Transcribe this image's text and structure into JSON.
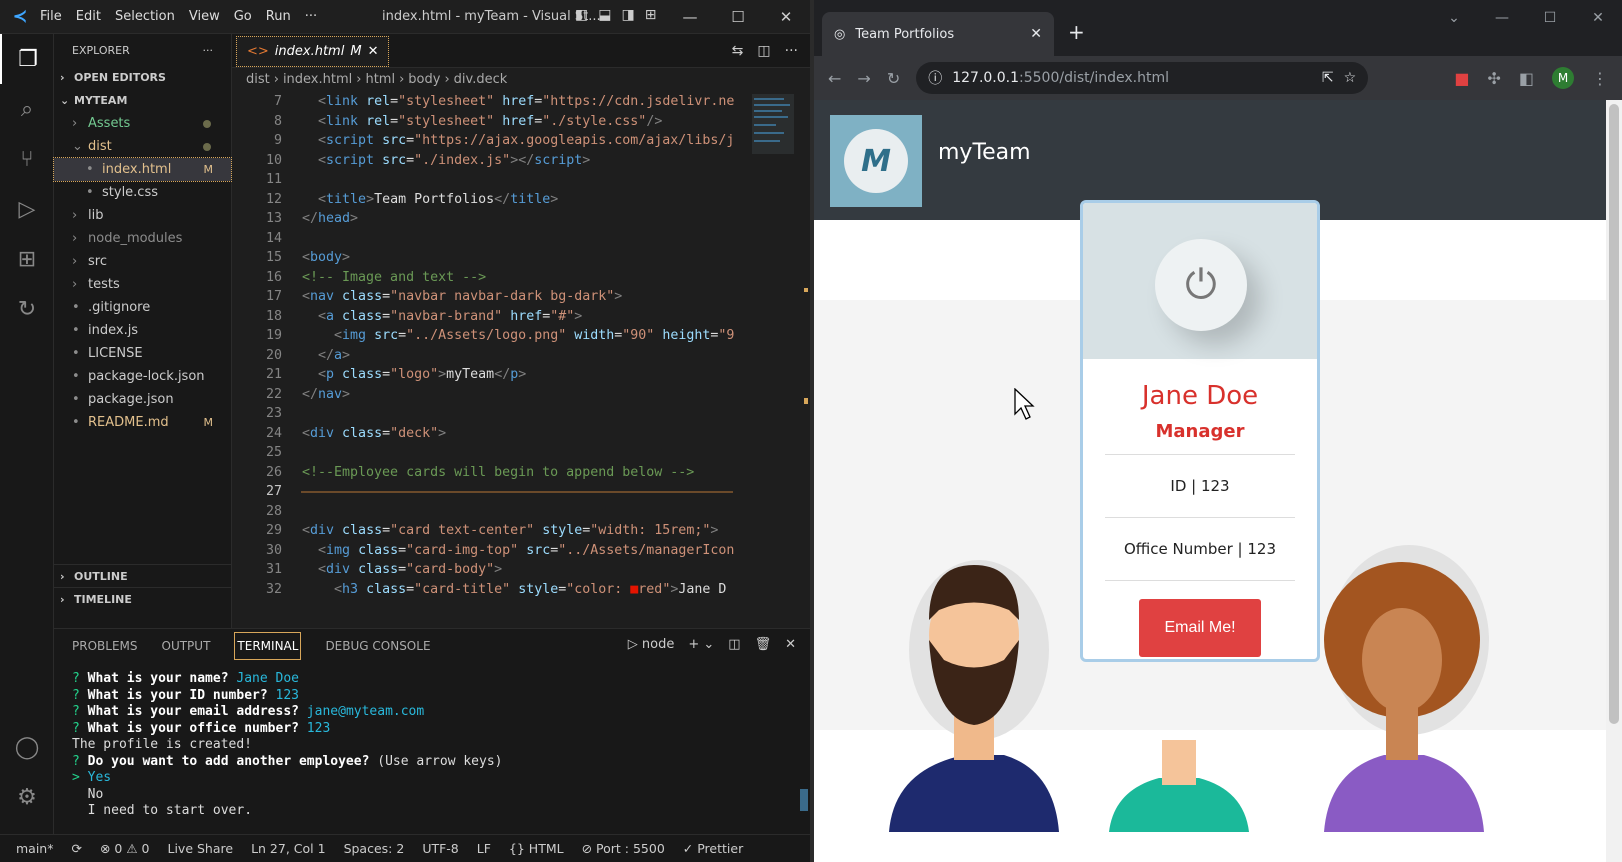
{
  "vscode": {
    "menu": [
      "File",
      "Edit",
      "Selection",
      "View",
      "Go",
      "Run",
      "···"
    ],
    "window_title": "index.html - myTeam - Visual St...",
    "explorer": {
      "title": "EXPLORER",
      "open_editors": "OPEN EDITORS",
      "project": "MYTEAM",
      "items": [
        {
          "label": "Assets",
          "type": "folder",
          "indent": 1,
          "decor": "dot",
          "color": "#73c991"
        },
        {
          "label": "dist",
          "type": "folder-open",
          "indent": 1,
          "decor": "dot",
          "color": "#e2c08d"
        },
        {
          "label": "index.html",
          "type": "file",
          "indent": 2,
          "decor": "M",
          "color": "#e2c08d",
          "selected": true
        },
        {
          "label": "style.css",
          "type": "file",
          "indent": 2,
          "color": "#ccc"
        },
        {
          "label": "lib",
          "type": "folder",
          "indent": 1,
          "color": "#ccc"
        },
        {
          "label": "node_modules",
          "type": "folder",
          "indent": 1,
          "color": "#8c8c8c"
        },
        {
          "label": "src",
          "type": "folder",
          "indent": 1,
          "color": "#ccc"
        },
        {
          "label": "tests",
          "type": "folder",
          "indent": 1,
          "color": "#ccc"
        },
        {
          "label": ".gitignore",
          "type": "file",
          "indent": 1,
          "color": "#ccc"
        },
        {
          "label": "index.js",
          "type": "file",
          "indent": 1,
          "color": "#ccc"
        },
        {
          "label": "LICENSE",
          "type": "file",
          "indent": 1,
          "color": "#ccc"
        },
        {
          "label": "package-lock.json",
          "type": "file",
          "indent": 1,
          "color": "#ccc"
        },
        {
          "label": "package.json",
          "type": "file",
          "indent": 1,
          "color": "#ccc"
        },
        {
          "label": "README.md",
          "type": "file",
          "indent": 1,
          "decor": "M",
          "color": "#e2c08d"
        }
      ],
      "outline": "OUTLINE",
      "timeline": "TIMELINE"
    },
    "tab": {
      "label": "index.html",
      "mark": "M"
    },
    "breadcrumb": [
      "dist",
      "index.html",
      "html",
      "body",
      "div.deck"
    ],
    "code": [
      {
        "n": "7",
        "parts": [
          [
            "tag",
            "  <"
          ],
          [
            "tn",
            "link "
          ],
          [
            "an",
            "rel"
          ],
          [
            "tt",
            "="
          ],
          [
            "av",
            "\"stylesheet\" "
          ],
          [
            "an",
            "href"
          ],
          [
            "tt",
            "="
          ],
          [
            "av",
            "\"https://cdn.jsdelivr.ne"
          ]
        ]
      },
      {
        "n": "8",
        "parts": [
          [
            "tag",
            "  <"
          ],
          [
            "tn",
            "link "
          ],
          [
            "an",
            "rel"
          ],
          [
            "tt",
            "="
          ],
          [
            "av",
            "\"stylesheet\" "
          ],
          [
            "an",
            "href"
          ],
          [
            "tt",
            "="
          ],
          [
            "av",
            "\"./style.css\""
          ],
          [
            "tag",
            "/>"
          ]
        ]
      },
      {
        "n": "9",
        "parts": [
          [
            "tag",
            "  <"
          ],
          [
            "tn",
            "script "
          ],
          [
            "an",
            "src"
          ],
          [
            "tt",
            "="
          ],
          [
            "av",
            "\"https://ajax.googleapis.com/ajax/libs/j"
          ]
        ]
      },
      {
        "n": "10",
        "parts": [
          [
            "tag",
            "  <"
          ],
          [
            "tn",
            "script "
          ],
          [
            "an",
            "src"
          ],
          [
            "tt",
            "="
          ],
          [
            "av",
            "\"./index.js\""
          ],
          [
            "tag",
            "></"
          ],
          [
            "tn",
            "script"
          ],
          [
            "tag",
            ">"
          ]
        ]
      },
      {
        "n": "11",
        "parts": []
      },
      {
        "n": "12",
        "parts": [
          [
            "tag",
            "  <"
          ],
          [
            "tn",
            "title"
          ],
          [
            "tag",
            ">"
          ],
          [
            "tt",
            "Team Portfolios"
          ],
          [
            "tag",
            "</"
          ],
          [
            "tn",
            "title"
          ],
          [
            "tag",
            ">"
          ]
        ]
      },
      {
        "n": "13",
        "parts": [
          [
            "tag",
            "</"
          ],
          [
            "tn",
            "head"
          ],
          [
            "tag",
            ">"
          ]
        ]
      },
      {
        "n": "14",
        "parts": []
      },
      {
        "n": "15",
        "parts": [
          [
            "tag",
            "<"
          ],
          [
            "tn",
            "body"
          ],
          [
            "tag",
            ">"
          ]
        ]
      },
      {
        "n": "16",
        "parts": [
          [
            "cm",
            "<!-- Image and text -->"
          ]
        ]
      },
      {
        "n": "17",
        "parts": [
          [
            "tag",
            "<"
          ],
          [
            "tn",
            "nav "
          ],
          [
            "an",
            "class"
          ],
          [
            "tt",
            "="
          ],
          [
            "av",
            "\"navbar navbar-dark bg-dark\""
          ],
          [
            "tag",
            ">"
          ]
        ]
      },
      {
        "n": "18",
        "parts": [
          [
            "tag",
            "  <"
          ],
          [
            "tn",
            "a "
          ],
          [
            "an",
            "class"
          ],
          [
            "tt",
            "="
          ],
          [
            "av",
            "\"navbar-brand\" "
          ],
          [
            "an",
            "href"
          ],
          [
            "tt",
            "="
          ],
          [
            "av",
            "\"#\""
          ],
          [
            "tag",
            ">"
          ]
        ]
      },
      {
        "n": "19",
        "parts": [
          [
            "tag",
            "    <"
          ],
          [
            "tn",
            "img "
          ],
          [
            "an",
            "src"
          ],
          [
            "tt",
            "="
          ],
          [
            "av",
            "\"../Assets/logo.png\" "
          ],
          [
            "an",
            "width"
          ],
          [
            "tt",
            "="
          ],
          [
            "av",
            "\"90\" "
          ],
          [
            "an",
            "height"
          ],
          [
            "tt",
            "="
          ],
          [
            "av",
            "\"9"
          ]
        ]
      },
      {
        "n": "20",
        "parts": [
          [
            "tag",
            "  </"
          ],
          [
            "tn",
            "a"
          ],
          [
            "tag",
            ">"
          ]
        ]
      },
      {
        "n": "21",
        "parts": [
          [
            "tag",
            "  <"
          ],
          [
            "tn",
            "p "
          ],
          [
            "an",
            "class"
          ],
          [
            "tt",
            "="
          ],
          [
            "av",
            "\"logo\""
          ],
          [
            "tag",
            ">"
          ],
          [
            "tt",
            "myTeam"
          ],
          [
            "tag",
            "</"
          ],
          [
            "tn",
            "p"
          ],
          [
            "tag",
            ">"
          ]
        ]
      },
      {
        "n": "22",
        "parts": [
          [
            "tag",
            "</"
          ],
          [
            "tn",
            "nav"
          ],
          [
            "tag",
            ">"
          ]
        ]
      },
      {
        "n": "23",
        "parts": []
      },
      {
        "n": "24",
        "parts": [
          [
            "tag",
            "<"
          ],
          [
            "tn",
            "div "
          ],
          [
            "an",
            "class"
          ],
          [
            "tt",
            "="
          ],
          [
            "av",
            "\"deck\""
          ],
          [
            "tag",
            ">"
          ]
        ]
      },
      {
        "n": "25",
        "parts": []
      },
      {
        "n": "26",
        "parts": [
          [
            "cm",
            "<!--Employee cards will begin to append below -->"
          ]
        ]
      },
      {
        "n": "27",
        "parts": [],
        "current": true
      },
      {
        "n": "28",
        "parts": []
      },
      {
        "n": "29",
        "parts": [
          [
            "tag",
            "<"
          ],
          [
            "tn",
            "div "
          ],
          [
            "an",
            "class"
          ],
          [
            "tt",
            "="
          ],
          [
            "av",
            "\"card text-center\" "
          ],
          [
            "an",
            "style"
          ],
          [
            "tt",
            "="
          ],
          [
            "av",
            "\"width: 15rem;\""
          ],
          [
            "tag",
            ">"
          ]
        ]
      },
      {
        "n": "30",
        "parts": [
          [
            "tag",
            "  <"
          ],
          [
            "tn",
            "img "
          ],
          [
            "an",
            "class"
          ],
          [
            "tt",
            "="
          ],
          [
            "av",
            "\"card-img-top\" "
          ],
          [
            "an",
            "src"
          ],
          [
            "tt",
            "="
          ],
          [
            "av",
            "\"../Assets/managerIcon"
          ]
        ]
      },
      {
        "n": "31",
        "parts": [
          [
            "tag",
            "  <"
          ],
          [
            "tn",
            "div "
          ],
          [
            "an",
            "class"
          ],
          [
            "tt",
            "="
          ],
          [
            "av",
            "\"card-body\""
          ],
          [
            "tag",
            ">"
          ]
        ]
      },
      {
        "n": "32",
        "parts": [
          [
            "tag",
            "    <"
          ],
          [
            "tn",
            "h3 "
          ],
          [
            "an",
            "class"
          ],
          [
            "tt",
            "="
          ],
          [
            "av",
            "\"card-title\" "
          ],
          [
            "an",
            "style"
          ],
          [
            "tt",
            "="
          ],
          [
            "av",
            "\"color: "
          ],
          [
            "red",
            "■"
          ],
          [
            "av",
            "red\""
          ],
          [
            "tag",
            ">"
          ],
          [
            "tt",
            "Jane D"
          ]
        ]
      }
    ],
    "panel_tabs": [
      "PROBLEMS",
      "OUTPUT",
      "TERMINAL",
      "DEBUG CONSOLE"
    ],
    "terminal_shell": "node",
    "terminal": [
      {
        "pre": "? ",
        "q": "What is your name?",
        "a": " Jane Doe"
      },
      {
        "pre": "? ",
        "q": "What is your ID number?",
        "a": " 123"
      },
      {
        "pre": "? ",
        "q": "What is your email address?",
        "a": " jane@myteam.com"
      },
      {
        "pre": "? ",
        "q": "What is your office number?",
        "a": " 123"
      },
      {
        "pre": "",
        "q": "",
        "a": "",
        "plain": "The profile is created!"
      },
      {
        "pre": "? ",
        "q": "Do you want to add another employee?",
        "a": "",
        "plain": " (Use arrow keys)"
      },
      {
        "pre": "> ",
        "q": "",
        "a": "Yes",
        "sel": true
      },
      {
        "pre": "  ",
        "q": "",
        "a": "",
        "plain": "No"
      },
      {
        "pre": "  ",
        "q": "",
        "a": "",
        "plain": "I need to start over."
      }
    ],
    "status": [
      "main*",
      "⟳",
      "⊗ 0 ⚠ 0",
      "Live Share",
      "Ln 27, Col 1",
      "Spaces: 2",
      "UTF-8",
      "LF",
      "{} HTML",
      "⊘ Port : 5500",
      "✓ Prettier"
    ]
  },
  "browser": {
    "tab_title": "Team Portfolios",
    "url_host": "127.0.0.1",
    "url_rest": ":5500/dist/index.html",
    "avatar_letter": "M",
    "site": {
      "brand": "myTeam",
      "logo_letter": "M",
      "card": {
        "name": "Jane Doe",
        "role": "Manager",
        "id": "ID | 123",
        "office": "Office Number | 123",
        "button": "Email Me!"
      }
    }
  }
}
